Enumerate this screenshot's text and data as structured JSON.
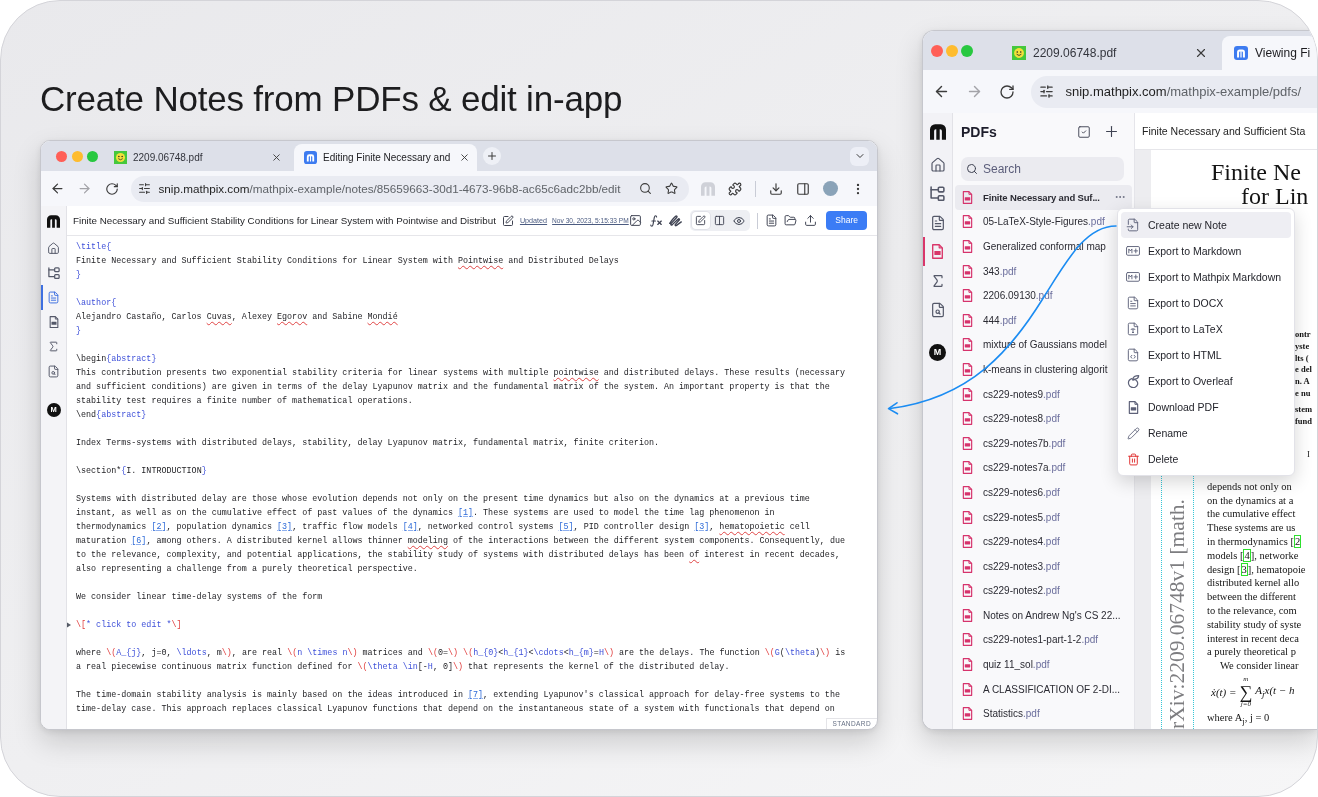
{
  "headline": "Create Notes from PDFs & edit in-app",
  "editor_window": {
    "tabs": [
      {
        "kind": "pdf_file",
        "title": "2209.06748.pdf",
        "selected": false
      },
      {
        "kind": "app_page",
        "title": "Editing Finite Necessary and",
        "selected": true
      }
    ],
    "url": {
      "host": "snip.mathpix.com",
      "path": "/mathpix-example/notes/85659663-30d1-4673-96b8-ac65c6adc2bb/edit"
    },
    "nav": [
      {
        "kind": "home",
        "selected": false
      },
      {
        "kind": "hierarchy",
        "selected": false
      },
      {
        "kind": "notes",
        "selected": true
      },
      {
        "kind": "pdfs",
        "selected": false
      },
      {
        "kind": "math",
        "selected": false
      },
      {
        "kind": "search",
        "selected": false
      }
    ],
    "avatar": "M",
    "note_title": "Finite Necessary and Sufficient Stability Conditions for Linear System with Pointwise and Distribut",
    "updated_label": "Updated",
    "updated_time": "Nov 30, 2023, 5:15:33 PM",
    "view_modes": [
      {
        "kind": "edit",
        "selected": true
      },
      {
        "kind": "split",
        "selected": false
      },
      {
        "kind": "preview",
        "selected": false
      }
    ],
    "share_button": "Share",
    "blocks": [
      {
        "kind": "text",
        "lines": [
          [
            {
              "kind": "syntax",
              "text": "\\title{"
            }
          ],
          [
            {
              "kind": "plain",
              "text": "Finite Necessary and Sufficient Stability Conditions for Linear System with "
            },
            {
              "kind": "misspelled",
              "text": "Pointwise"
            },
            {
              "kind": "plain",
              "text": " and Distributed Delays"
            }
          ],
          [
            {
              "kind": "syntax",
              "text": "}"
            }
          ]
        ]
      },
      {
        "kind": "text",
        "lines": [
          [
            {
              "kind": "syntax",
              "text": "\\author{"
            }
          ],
          [
            {
              "kind": "plain",
              "text": "Alejandro Castaño, Carlos "
            },
            {
              "kind": "misspelled",
              "text": "Cuvas"
            },
            {
              "kind": "plain",
              "text": ", Alexey "
            },
            {
              "kind": "misspelled",
              "text": "Egorov"
            },
            {
              "kind": "plain",
              "text": " and Sabine "
            },
            {
              "kind": "misspelled",
              "text": "Mondié"
            }
          ],
          [
            {
              "kind": "syntax",
              "text": "}"
            }
          ]
        ]
      },
      {
        "kind": "text",
        "lines": [
          [
            {
              "kind": "plain",
              "text": "\\begin"
            },
            {
              "kind": "syntax",
              "text": "{abstract}"
            }
          ],
          [
            {
              "kind": "plain",
              "text": "This contribution presents two exponential stability criteria for linear systems with multiple "
            },
            {
              "kind": "misspelled",
              "text": "pointwise"
            },
            {
              "kind": "plain",
              "text": " and distributed delays. These results (necessary"
            }
          ],
          [
            {
              "kind": "plain",
              "text": "and sufficient conditions) are given in terms of the delay Lyapunov matrix and the fundamental matrix of the system. An important property is that the"
            }
          ],
          [
            {
              "kind": "plain",
              "text": "stability test requires a finite number of mathematical operations."
            }
          ],
          [
            {
              "kind": "plain",
              "text": "\\end"
            },
            {
              "kind": "syntax",
              "text": "{abstract}"
            }
          ]
        ]
      },
      {
        "kind": "text",
        "lines": [
          [
            {
              "kind": "plain",
              "text": "Index Terms-systems with distributed delays, stability, delay Lyapunov matrix, fundamental matrix, finite criterion."
            }
          ]
        ]
      },
      {
        "kind": "text",
        "lines": [
          [
            {
              "kind": "plain",
              "text": "\\section*"
            },
            {
              "kind": "syntax",
              "text": "{"
            },
            {
              "kind": "plain",
              "text": "I. INTRODUCTION"
            },
            {
              "kind": "syntax",
              "text": "}"
            }
          ]
        ]
      },
      {
        "kind": "text",
        "lines": [
          [
            {
              "kind": "plain",
              "text": "Systems with distributed delay are those whose evolution depends not only on the present time dynamics but also on the dynamics at a previous time"
            }
          ],
          [
            {
              "kind": "plain",
              "text": "instant, as well as on the cumulative effect of past values of the dynamics "
            },
            {
              "kind": "ref",
              "text": "[1]"
            },
            {
              "kind": "plain",
              "text": ". These systems are used to model the time lag phenomenon in"
            }
          ],
          [
            {
              "kind": "plain",
              "text": "thermodynamics "
            },
            {
              "kind": "ref",
              "text": "[2]"
            },
            {
              "kind": "plain",
              "text": ", population dynamics "
            },
            {
              "kind": "ref",
              "text": "[3]"
            },
            {
              "kind": "plain",
              "text": ", traffic flow models "
            },
            {
              "kind": "ref",
              "text": "[4]"
            },
            {
              "kind": "plain",
              "text": ", networked control systems "
            },
            {
              "kind": "ref",
              "text": "[5]"
            },
            {
              "kind": "plain",
              "text": ", PID controller design "
            },
            {
              "kind": "ref",
              "text": "[3]"
            },
            {
              "kind": "plain",
              "text": ", "
            },
            {
              "kind": "misspelled",
              "text": "hematopoietic"
            },
            {
              "kind": "plain",
              "text": " cell"
            }
          ],
          [
            {
              "kind": "plain",
              "text": "maturation "
            },
            {
              "kind": "ref",
              "text": "[6]"
            },
            {
              "kind": "plain",
              "text": ", among others. A distributed kernel allows thinner "
            },
            {
              "kind": "misspelled",
              "text": "modeling"
            },
            {
              "kind": "plain",
              "text": " of the interactions between the different system components. Consequently, due"
            }
          ],
          [
            {
              "kind": "plain",
              "text": "to the relevance, complexity, and potential applications, the stability study of systems with distributed delays has been "
            },
            {
              "kind": "misspelled",
              "text": "of"
            },
            {
              "kind": "plain",
              "text": " interest in recent decades,"
            }
          ],
          [
            {
              "kind": "plain",
              "text": "also representing a challenge from a purely theoretical perspective."
            }
          ]
        ]
      },
      {
        "kind": "text",
        "lines": [
          [
            {
              "kind": "plain",
              "text": "We consider linear time-delay systems of the form"
            }
          ]
        ]
      },
      {
        "kind": "display_math",
        "lines": [
          [
            {
              "kind": "math_delim",
              "text": "\\["
            },
            {
              "kind": "math",
              "text": "* click to edit *"
            },
            {
              "kind": "math_delim",
              "text": "\\]"
            }
          ]
        ]
      },
      {
        "kind": "text",
        "lines": [
          [
            {
              "kind": "plain",
              "text": "where "
            },
            {
              "kind": "math_delim",
              "text": "\\("
            },
            {
              "kind": "math",
              "text": "A_{j}"
            },
            {
              "kind": "plain",
              "text": ", j=0, "
            },
            {
              "kind": "math",
              "text": "\\ldots"
            },
            {
              "kind": "plain",
              "text": ", m"
            },
            {
              "kind": "math_delim",
              "text": "\\)"
            },
            {
              "kind": "plain",
              "text": ", are real "
            },
            {
              "kind": "math_delim",
              "text": "\\("
            },
            {
              "kind": "math",
              "text": "n \\times n"
            },
            {
              "kind": "math_delim",
              "text": "\\)"
            },
            {
              "kind": "plain",
              "text": " matrices and "
            },
            {
              "kind": "math_delim",
              "text": "\\("
            },
            {
              "kind": "plain",
              "text": "0="
            },
            {
              "kind": "math_delim",
              "text": "\\) \\("
            },
            {
              "kind": "math",
              "text": "h_{0}"
            },
            {
              "kind": "plain",
              "text": "<"
            },
            {
              "kind": "math",
              "text": "h_{1}"
            },
            {
              "kind": "plain",
              "text": "<"
            },
            {
              "kind": "math",
              "text": "\\cdots"
            },
            {
              "kind": "plain",
              "text": "<"
            },
            {
              "kind": "math",
              "text": "h_{m}"
            },
            {
              "kind": "plain",
              "text": "="
            },
            {
              "kind": "math",
              "text": "H"
            },
            {
              "kind": "math_delim",
              "text": "\\)"
            },
            {
              "kind": "plain",
              "text": " are the delays. The function "
            },
            {
              "kind": "math_delim",
              "text": "\\("
            },
            {
              "kind": "math",
              "text": "G"
            },
            {
              "kind": "plain",
              "text": "("
            },
            {
              "kind": "math",
              "text": "\\theta"
            },
            {
              "kind": "plain",
              "text": ")"
            },
            {
              "kind": "math_delim",
              "text": "\\)"
            },
            {
              "kind": "plain",
              "text": " is"
            }
          ],
          [
            {
              "kind": "plain",
              "text": "a real piecewise continuous matrix function defined for "
            },
            {
              "kind": "math_delim",
              "text": "\\("
            },
            {
              "kind": "math",
              "text": "\\theta \\in"
            },
            {
              "kind": "plain",
              "text": "[-"
            },
            {
              "kind": "math",
              "text": "H"
            },
            {
              "kind": "plain",
              "text": ", 0]"
            },
            {
              "kind": "math_delim",
              "text": "\\)"
            },
            {
              "kind": "plain",
              "text": " that represents the kernel of the distributed delay."
            }
          ]
        ]
      },
      {
        "kind": "text",
        "lines": [
          [
            {
              "kind": "plain",
              "text": "The time-domain stability analysis is mainly based on the ideas introduced in "
            },
            {
              "kind": "ref",
              "text": "[7]"
            },
            {
              "kind": "plain",
              "text": ", extending Lyapunov's classical approach for delay-free systems to the"
            }
          ],
          [
            {
              "kind": "plain",
              "text": "time-delay case. This approach replaces classical Lyapunov functions that depend on the instantaneous state of a system with functionals that depend on"
            }
          ]
        ]
      }
    ],
    "mode_label": "STANDARD"
  },
  "viewer_window": {
    "tabs": [
      {
        "kind": "pdf_file",
        "title": "2209.06748.pdf",
        "selected": false
      },
      {
        "kind": "app_page",
        "title": "Viewing Fi",
        "selected": true
      }
    ],
    "url": {
      "host": "snip.mathpix.com",
      "path": "/mathpix-example/pdfs/"
    },
    "nav": [
      {
        "kind": "home",
        "selected": false
      },
      {
        "kind": "hierarchy",
        "selected": false
      },
      {
        "kind": "notes",
        "selected": false
      },
      {
        "kind": "pdfs",
        "selected": true
      },
      {
        "kind": "math",
        "selected": false
      },
      {
        "kind": "search",
        "selected": false
      }
    ],
    "avatar": "M",
    "panel_title": "PDFs",
    "search": {
      "placeholder": "Search"
    },
    "files": [
      {
        "name": "Finite Necessary and Suf...",
        "selected": true
      },
      {
        "name": "05-LaTeX-Style-Figures",
        "extension": ".pdf",
        "selected": false
      },
      {
        "name": "Generalized conformal map",
        "selected": false
      },
      {
        "name": "343",
        "extension": ".pdf",
        "selected": false
      },
      {
        "name": "2206.09130",
        "extension": ".pdf",
        "selected": false
      },
      {
        "name": "444",
        "extension": ".pdf",
        "selected": false
      },
      {
        "name": "mixture of Gaussians model",
        "selected": false
      },
      {
        "name": "k-means in clustering algorit",
        "selected": false
      },
      {
        "name": "cs229-notes9",
        "extension": ".pdf",
        "selected": false
      },
      {
        "name": "cs229-notes8",
        "extension": ".pdf",
        "selected": false
      },
      {
        "name": "cs229-notes7b",
        "extension": ".pdf",
        "selected": false
      },
      {
        "name": "cs229-notes7a",
        "extension": ".pdf",
        "selected": false
      },
      {
        "name": "cs229-notes6",
        "extension": ".pdf",
        "selected": false
      },
      {
        "name": "cs229-notes5",
        "extension": ".pdf",
        "selected": false
      },
      {
        "name": "cs229-notes4",
        "extension": ".pdf",
        "selected": false
      },
      {
        "name": "cs229-notes3",
        "extension": ".pdf",
        "selected": false
      },
      {
        "name": "cs229-notes2",
        "extension": ".pdf",
        "selected": false
      },
      {
        "name": "Notes on Andrew Ng's CS 22...",
        "selected": false
      },
      {
        "name": "cs229-notes1-part-1-2",
        "extension": ".pdf",
        "selected": false
      },
      {
        "name": "quiz 11_sol",
        "extension": ".pdf",
        "selected": false
      },
      {
        "name": "A CLASSIFICATION OF 2-DI...",
        "selected": false
      },
      {
        "name": "Statistics",
        "extension": ".pdf",
        "selected": false
      }
    ],
    "menu": [
      {
        "kind": "new_note",
        "label": "Create new Note",
        "selected": true
      },
      {
        "kind": "markdown",
        "label": "Export to Markdown",
        "selected": false
      },
      {
        "kind": "markdown",
        "label": "Export to Mathpix Markdown",
        "selected": false
      },
      {
        "kind": "docx",
        "label": "Export to DOCX",
        "selected": false
      },
      {
        "kind": "latex",
        "label": "Export to LaTeX",
        "selected": false
      },
      {
        "kind": "html",
        "label": "Export to HTML",
        "selected": false
      },
      {
        "kind": "overleaf",
        "label": "Export to Overleaf",
        "selected": false
      },
      {
        "kind": "pdf",
        "label": "Download PDF",
        "selected": false
      },
      {
        "kind": "rename",
        "label": "Rename",
        "selected": false
      },
      {
        "kind": "delete",
        "label": "Delete",
        "selected": false
      }
    ],
    "document_title": "Finite Necessary and Sufficient Sta",
    "pdf_page": {
      "title_lines": [
        "Finite Ne",
        "for Lin"
      ],
      "abstract_fragments": [
        "ontr",
        "yste",
        "lts (",
        "e del",
        "n. A",
        "e nu"
      ],
      "keyword_fragments": [
        "stem",
        "fund"
      ],
      "heading_fragment": "I",
      "body_lines": [
        [
          {
            "kind": "plain",
            "text": "depends not only on"
          }
        ],
        [
          {
            "kind": "plain",
            "text": "on the dynamics at a"
          }
        ],
        [
          {
            "kind": "plain",
            "text": "the cumulative effect"
          }
        ],
        [
          {
            "kind": "plain",
            "text": "These systems are us"
          }
        ],
        [
          {
            "kind": "plain",
            "text": "in thermodynamics ["
          },
          {
            "kind": "cite",
            "text": "2"
          }
        ],
        [
          {
            "kind": "plain",
            "text": "models ["
          },
          {
            "kind": "cite",
            "text": "4"
          },
          {
            "kind": "plain",
            "text": "], networke"
          }
        ],
        [
          {
            "kind": "plain",
            "text": "design ["
          },
          {
            "kind": "cite",
            "text": "3"
          },
          {
            "kind": "plain",
            "text": "], hematopoie"
          }
        ],
        [
          {
            "kind": "plain",
            "text": "distributed kernel allo"
          }
        ],
        [
          {
            "kind": "plain",
            "text": "between the different"
          }
        ],
        [
          {
            "kind": "plain",
            "text": "to the relevance, com"
          }
        ],
        [
          {
            "kind": "plain",
            "text": "stability study of syste"
          }
        ],
        [
          {
            "kind": "plain",
            "text": "interest in recent deca"
          }
        ],
        [
          {
            "kind": "plain",
            "text": "a purely theoretical p"
          }
        ]
      ],
      "equation_intro": "We consider linear",
      "equation": {
        "lhs": "ẋ(t) =",
        "operator": "∑",
        "upper": "m",
        "lower": "j=0",
        "rhs": "A$_{j}$x(t − h"
      },
      "after_equation": "where A$_{j}$, j = 0",
      "arxiv_stamp": "rXiv:2209.06748v1 [math."
    }
  }
}
